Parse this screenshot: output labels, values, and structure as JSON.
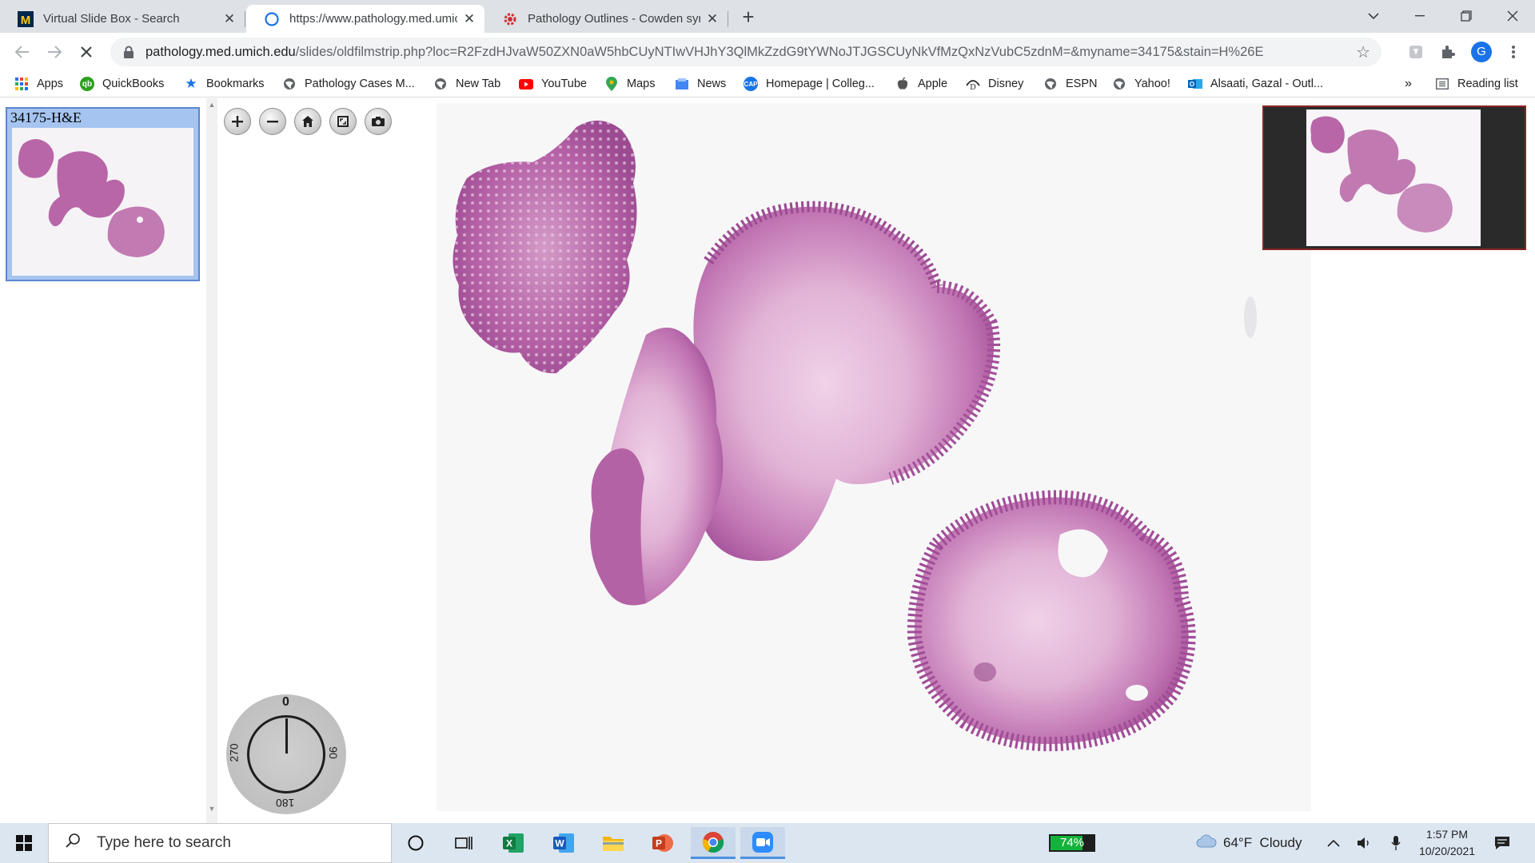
{
  "browser": {
    "tabs": [
      {
        "title": "Virtual Slide Box - Search",
        "favicon": "umich-m-icon",
        "active": false
      },
      {
        "title": "https://www.pathology.med.umich.edu",
        "favicon": "loading-spinner-icon",
        "active": true
      },
      {
        "title": "Pathology Outlines - Cowden syndrome",
        "favicon": "pathology-outlines-icon",
        "active": false
      }
    ],
    "url_host": "pathology.med.umich.edu",
    "url_path": "/slides/oldfilmstrip.php?loc=R2FzdHJvaW50ZXN0aW5hbCUyNTIwVHJhY3QlMkZzdG9tYWNoJTJGSCUyNkVfMzQxNzVubC5zdnM=&myname=34175&stain=H%26E",
    "profile_initial": "G",
    "bookmarks": [
      {
        "label": "Apps",
        "icon": "apps-grid-icon"
      },
      {
        "label": "QuickBooks",
        "icon": "quickbooks-icon"
      },
      {
        "label": "Bookmarks",
        "icon": "star-icon"
      },
      {
        "label": "Pathology Cases M...",
        "icon": "globe-icon"
      },
      {
        "label": "New Tab",
        "icon": "globe-icon"
      },
      {
        "label": "YouTube",
        "icon": "youtube-icon"
      },
      {
        "label": "Maps",
        "icon": "maps-pin-icon"
      },
      {
        "label": "News",
        "icon": "news-icon"
      },
      {
        "label": "Homepage | Colleg...",
        "icon": "cap-icon"
      },
      {
        "label": "Apple",
        "icon": "apple-icon"
      },
      {
        "label": "Disney",
        "icon": "disney-icon"
      },
      {
        "label": "ESPN",
        "icon": "globe-icon"
      },
      {
        "label": "Yahoo!",
        "icon": "globe-icon"
      },
      {
        "label": "Alsaati, Gazal - Outl...",
        "icon": "outlook-icon"
      }
    ],
    "overflow_label": "»",
    "reading_list_label": "Reading list"
  },
  "viewer": {
    "slide_label": "34175-H&E",
    "tools": [
      "zoom-in",
      "zoom-out",
      "home",
      "fullscreen",
      "snapshot"
    ],
    "rotation": {
      "top": "0",
      "right": "90",
      "bottom": "180",
      "left": "270",
      "angle": 0
    }
  },
  "taskbar": {
    "search_placeholder": "Type here to search",
    "battery_percent": 74,
    "battery_label": "74%",
    "weather": "64°F  Cloudy",
    "time": "1:57 PM",
    "date": "10/20/2021"
  },
  "colors": {
    "tissue": "#b35a9e",
    "tissue_light": "#d693c8",
    "selection": "#a6c4f0",
    "taskbar": "#dce6f1"
  }
}
